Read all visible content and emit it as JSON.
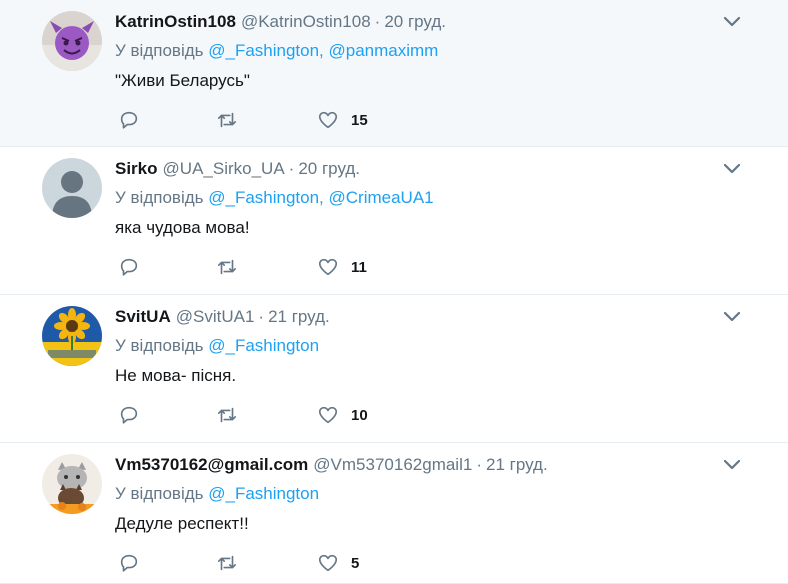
{
  "tweets": [
    {
      "name": "KatrinOstin108",
      "handle": "@KatrinOstin108",
      "date": "20 груд.",
      "replying_prefix": "У відповідь",
      "mentions": "@_Fashington, @panmaximm",
      "text": "\"Живи Беларусь\"",
      "likes": "15",
      "avatar": "devil-emoji-avatar"
    },
    {
      "name": "Sirko",
      "handle": "@UA_Sirko_UA",
      "date": "20 груд.",
      "replying_prefix": "У відповідь",
      "mentions": "@_Fashington, @CrimeaUA1",
      "text": "яка чудова мова!",
      "likes": "11",
      "avatar": "default-avatar"
    },
    {
      "name": "SvitUA",
      "handle": "@SvitUA1",
      "date": "21 груд.",
      "replying_prefix": "У відповідь",
      "mentions": "@_Fashington",
      "text": "Не мова- пісня.",
      "likes": "10",
      "avatar": "sunflower-avatar"
    },
    {
      "name": "Vm5370162@gmail.com",
      "handle": "@Vm5370162gmail1",
      "date": "21 груд.",
      "replying_prefix": "У відповідь",
      "mentions": "@_Fashington",
      "text": "Дедуле респект!!",
      "likes": "5",
      "avatar": "cats-avatar"
    }
  ],
  "dot_separator": "·",
  "colors": {
    "accent": "#1da1f2",
    "muted": "#657786",
    "highlight_bg": "#f5f8fa"
  }
}
